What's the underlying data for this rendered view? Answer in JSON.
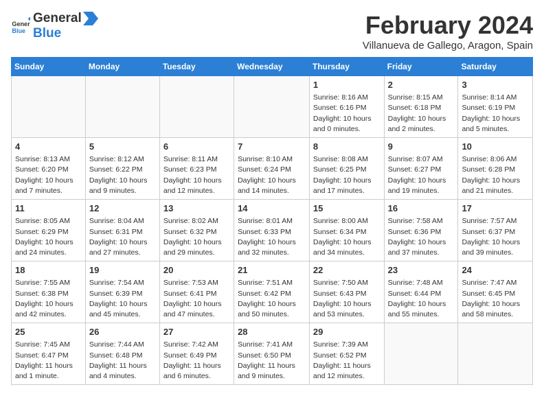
{
  "header": {
    "logo_general": "General",
    "logo_blue": "Blue",
    "month_year": "February 2024",
    "location": "Villanueva de Gallego, Aragon, Spain"
  },
  "days_of_week": [
    "Sunday",
    "Monday",
    "Tuesday",
    "Wednesday",
    "Thursday",
    "Friday",
    "Saturday"
  ],
  "weeks": [
    [
      {
        "date": "",
        "info": ""
      },
      {
        "date": "",
        "info": ""
      },
      {
        "date": "",
        "info": ""
      },
      {
        "date": "",
        "info": ""
      },
      {
        "date": "1",
        "info": "Sunrise: 8:16 AM\nSunset: 6:16 PM\nDaylight: 10 hours\nand 0 minutes."
      },
      {
        "date": "2",
        "info": "Sunrise: 8:15 AM\nSunset: 6:18 PM\nDaylight: 10 hours\nand 2 minutes."
      },
      {
        "date": "3",
        "info": "Sunrise: 8:14 AM\nSunset: 6:19 PM\nDaylight: 10 hours\nand 5 minutes."
      }
    ],
    [
      {
        "date": "4",
        "info": "Sunrise: 8:13 AM\nSunset: 6:20 PM\nDaylight: 10 hours\nand 7 minutes."
      },
      {
        "date": "5",
        "info": "Sunrise: 8:12 AM\nSunset: 6:22 PM\nDaylight: 10 hours\nand 9 minutes."
      },
      {
        "date": "6",
        "info": "Sunrise: 8:11 AM\nSunset: 6:23 PM\nDaylight: 10 hours\nand 12 minutes."
      },
      {
        "date": "7",
        "info": "Sunrise: 8:10 AM\nSunset: 6:24 PM\nDaylight: 10 hours\nand 14 minutes."
      },
      {
        "date": "8",
        "info": "Sunrise: 8:08 AM\nSunset: 6:25 PM\nDaylight: 10 hours\nand 17 minutes."
      },
      {
        "date": "9",
        "info": "Sunrise: 8:07 AM\nSunset: 6:27 PM\nDaylight: 10 hours\nand 19 minutes."
      },
      {
        "date": "10",
        "info": "Sunrise: 8:06 AM\nSunset: 6:28 PM\nDaylight: 10 hours\nand 21 minutes."
      }
    ],
    [
      {
        "date": "11",
        "info": "Sunrise: 8:05 AM\nSunset: 6:29 PM\nDaylight: 10 hours\nand 24 minutes."
      },
      {
        "date": "12",
        "info": "Sunrise: 8:04 AM\nSunset: 6:31 PM\nDaylight: 10 hours\nand 27 minutes."
      },
      {
        "date": "13",
        "info": "Sunrise: 8:02 AM\nSunset: 6:32 PM\nDaylight: 10 hours\nand 29 minutes."
      },
      {
        "date": "14",
        "info": "Sunrise: 8:01 AM\nSunset: 6:33 PM\nDaylight: 10 hours\nand 32 minutes."
      },
      {
        "date": "15",
        "info": "Sunrise: 8:00 AM\nSunset: 6:34 PM\nDaylight: 10 hours\nand 34 minutes."
      },
      {
        "date": "16",
        "info": "Sunrise: 7:58 AM\nSunset: 6:36 PM\nDaylight: 10 hours\nand 37 minutes."
      },
      {
        "date": "17",
        "info": "Sunrise: 7:57 AM\nSunset: 6:37 PM\nDaylight: 10 hours\nand 39 minutes."
      }
    ],
    [
      {
        "date": "18",
        "info": "Sunrise: 7:55 AM\nSunset: 6:38 PM\nDaylight: 10 hours\nand 42 minutes."
      },
      {
        "date": "19",
        "info": "Sunrise: 7:54 AM\nSunset: 6:39 PM\nDaylight: 10 hours\nand 45 minutes."
      },
      {
        "date": "20",
        "info": "Sunrise: 7:53 AM\nSunset: 6:41 PM\nDaylight: 10 hours\nand 47 minutes."
      },
      {
        "date": "21",
        "info": "Sunrise: 7:51 AM\nSunset: 6:42 PM\nDaylight: 10 hours\nand 50 minutes."
      },
      {
        "date": "22",
        "info": "Sunrise: 7:50 AM\nSunset: 6:43 PM\nDaylight: 10 hours\nand 53 minutes."
      },
      {
        "date": "23",
        "info": "Sunrise: 7:48 AM\nSunset: 6:44 PM\nDaylight: 10 hours\nand 55 minutes."
      },
      {
        "date": "24",
        "info": "Sunrise: 7:47 AM\nSunset: 6:45 PM\nDaylight: 10 hours\nand 58 minutes."
      }
    ],
    [
      {
        "date": "25",
        "info": "Sunrise: 7:45 AM\nSunset: 6:47 PM\nDaylight: 11 hours\nand 1 minute."
      },
      {
        "date": "26",
        "info": "Sunrise: 7:44 AM\nSunset: 6:48 PM\nDaylight: 11 hours\nand 4 minutes."
      },
      {
        "date": "27",
        "info": "Sunrise: 7:42 AM\nSunset: 6:49 PM\nDaylight: 11 hours\nand 6 minutes."
      },
      {
        "date": "28",
        "info": "Sunrise: 7:41 AM\nSunset: 6:50 PM\nDaylight: 11 hours\nand 9 minutes."
      },
      {
        "date": "29",
        "info": "Sunrise: 7:39 AM\nSunset: 6:52 PM\nDaylight: 11 hours\nand 12 minutes."
      },
      {
        "date": "",
        "info": ""
      },
      {
        "date": "",
        "info": ""
      }
    ]
  ]
}
